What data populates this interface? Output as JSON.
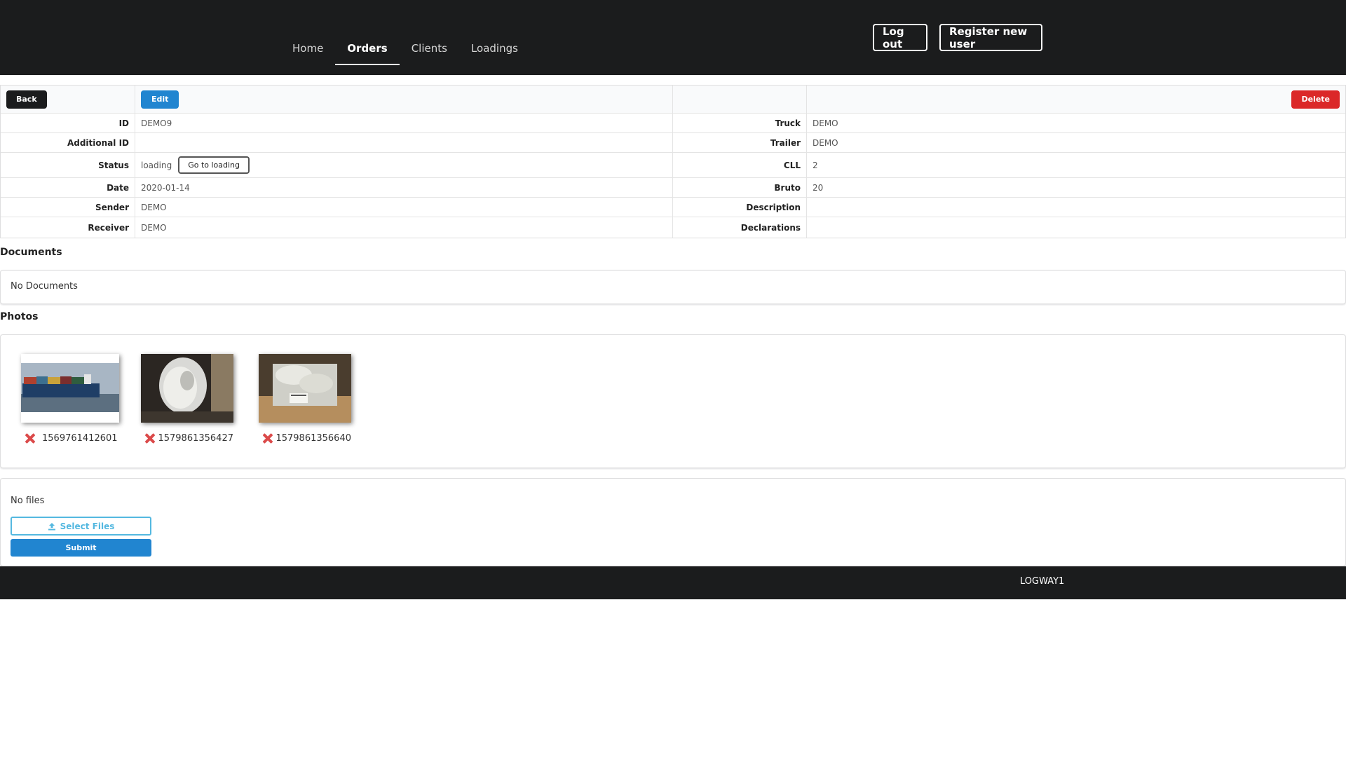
{
  "nav": {
    "items": [
      "Home",
      "Orders",
      "Clients",
      "Loadings"
    ],
    "active": "Orders",
    "logout_label": "Log out",
    "register_label": "Register new user"
  },
  "toolbar": {
    "back_label": "Back",
    "edit_label": "Edit",
    "delete_label": "Delete"
  },
  "details": {
    "left": [
      {
        "label": "ID",
        "value": "DEMO9"
      },
      {
        "label": "Additional ID",
        "value": ""
      },
      {
        "label": "Status",
        "value": "loading"
      },
      {
        "label": "Date",
        "value": "2020-01-14"
      },
      {
        "label": "Sender",
        "value": "DEMO"
      },
      {
        "label": "Receiver",
        "value": "DEMO"
      }
    ],
    "right": [
      {
        "label": "Truck",
        "value": "DEMO"
      },
      {
        "label": "Trailer",
        "value": "DEMO"
      },
      {
        "label": "CLL",
        "value": "2"
      },
      {
        "label": "Bruto",
        "value": "20"
      },
      {
        "label": "Description",
        "value": ""
      },
      {
        "label": "Declarations",
        "value": ""
      }
    ],
    "go_to_loading_label": "Go to loading"
  },
  "documents": {
    "title": "Documents",
    "empty_text": "No Documents"
  },
  "photos": {
    "title": "Photos",
    "items": [
      {
        "name": "1569761412601",
        "icon": "container-ship-photo"
      },
      {
        "name": "1579861356427",
        "icon": "wrapped-cargo-photo"
      },
      {
        "name": "1579861356640",
        "icon": "pallet-cargo-photo"
      }
    ]
  },
  "upload": {
    "no_files_text": "No files",
    "select_label": "Select Files",
    "submit_label": "Submit"
  },
  "footer": {
    "text": "LOGWAY1"
  },
  "colors": {
    "dark": "#1b1c1d",
    "primary": "#2185d0",
    "danger": "#db2828",
    "select_outline": "#54b8e0"
  }
}
